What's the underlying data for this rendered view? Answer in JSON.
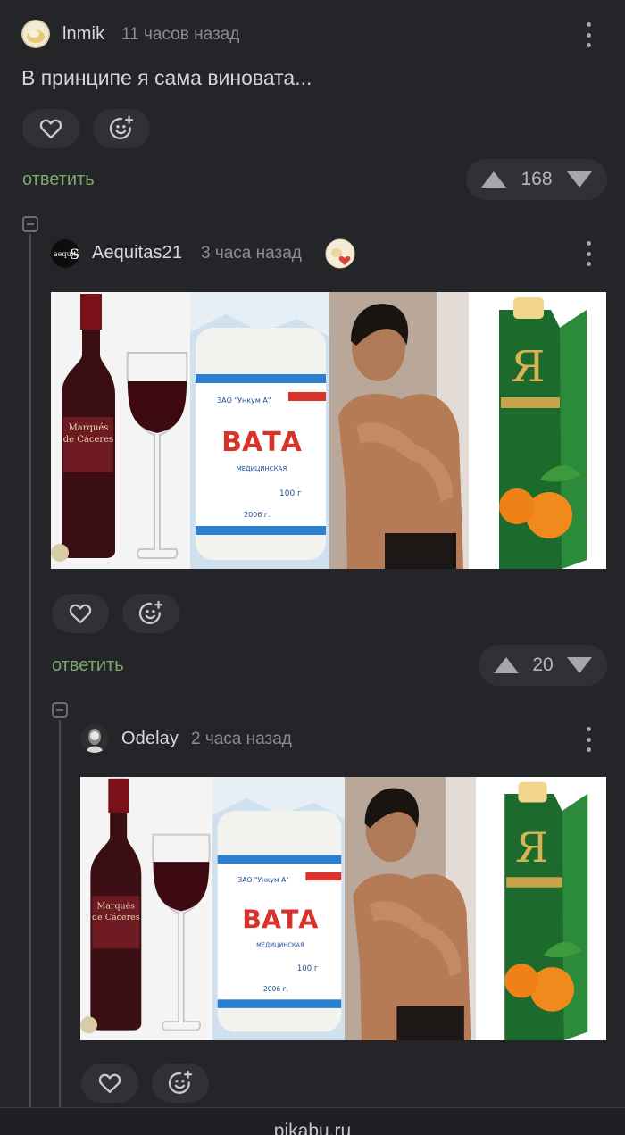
{
  "comments": [
    {
      "author": "lnmik",
      "time": "11 часов назад",
      "text": "В принципе я сама виновата...",
      "reply_label": "ответить",
      "rating": "168"
    },
    {
      "author": "Aequitas21",
      "time": "3 часа назад",
      "reply_label": "ответить",
      "rating": "20",
      "avatar_text": "aequitaS",
      "image": {
        "bottle_label": "Marqués de Cáceres",
        "vata_brand": "ВАТА",
        "vata_maker": "ЗАО \"Ункум А\"",
        "vata_year": "2006 г.",
        "vata_weight": "100 г",
        "juice_letter": "Я"
      }
    },
    {
      "author": "Odelay",
      "time": "2 часа назад",
      "image": {
        "bottle_label": "Marqués de Cáceres",
        "vata_brand": "ВАТА",
        "vata_maker": "ЗАО \"Ункум А\"",
        "vata_year": "2006 г.",
        "vata_weight": "100 г",
        "juice_letter": "Я"
      }
    }
  ],
  "footer": {
    "site": "pikabu.ru"
  },
  "icons": {
    "like": "heart-icon",
    "reaction": "add-emoji-icon",
    "upvote": "triangle-up-icon",
    "downvote": "triangle-down-icon",
    "more": "kebab-menu-icon",
    "collapse": "collapse-minus-icon"
  },
  "colors": {
    "background": "#242529",
    "reply": "#7fa86a",
    "button": "#303136"
  }
}
